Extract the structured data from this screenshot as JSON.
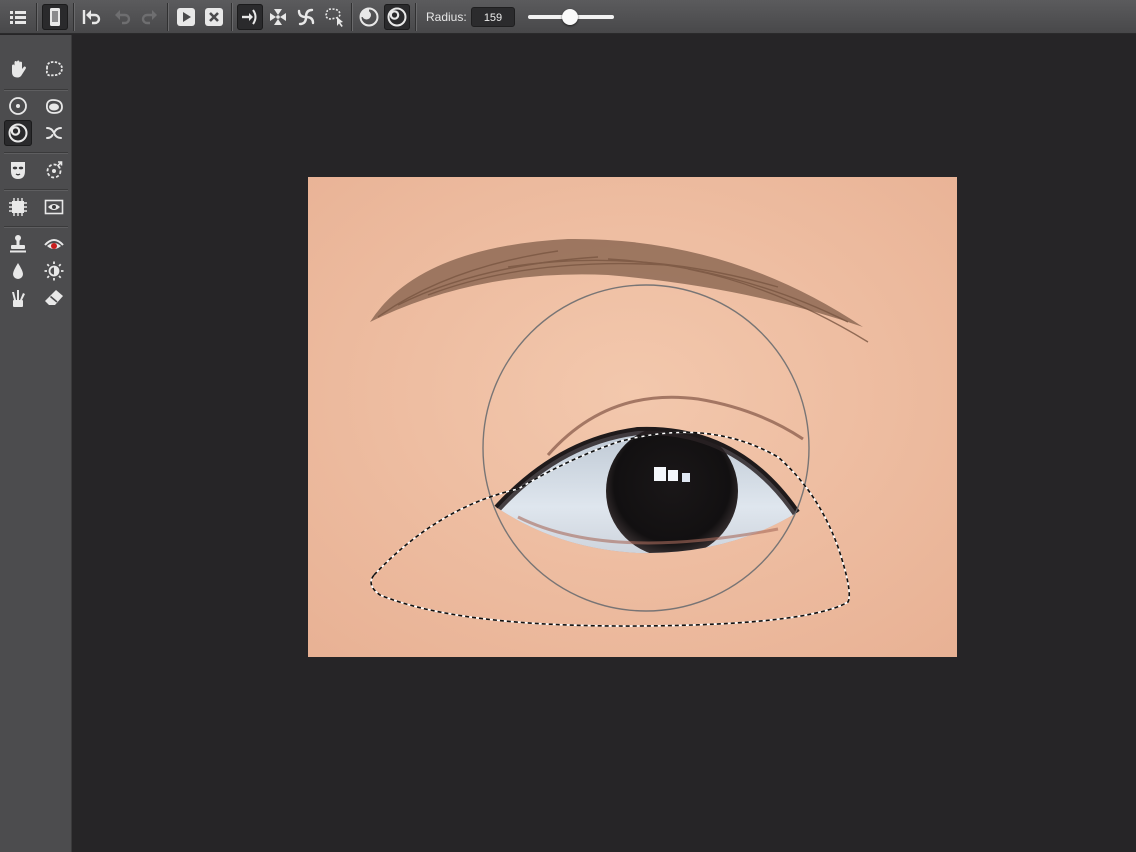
{
  "toolbar": {
    "radius_label": "Radius:",
    "radius_value": "159",
    "radius_slider_level": 0.49,
    "items": [
      {
        "name": "menu-icon"
      },
      {
        "name": "phone-icon",
        "active": true
      },
      {
        "name": "undo-all-icon"
      },
      {
        "name": "undo-icon"
      },
      {
        "name": "redo-icon"
      },
      {
        "name": "play-icon"
      },
      {
        "name": "cancel-icon"
      },
      {
        "name": "forward-warp-icon",
        "active": true
      },
      {
        "name": "pinch-icon"
      },
      {
        "name": "twirl-icon"
      },
      {
        "name": "lasso-select-icon"
      },
      {
        "name": "brush-mode-add-icon"
      },
      {
        "name": "brush-mode-subtract-icon",
        "active": true
      }
    ]
  },
  "sidebar": {
    "tools": [
      {
        "name": "hand-tool-icon"
      },
      {
        "name": "lasso-tool-icon"
      },
      {
        "name": "circle-select-icon"
      },
      {
        "name": "blob-select-icon"
      },
      {
        "name": "eye-enhance-icon",
        "active": true
      },
      {
        "name": "liquify-icon"
      },
      {
        "name": "mask-icon"
      },
      {
        "name": "target-icon"
      },
      {
        "name": "chip-icon"
      },
      {
        "name": "frame-eye-icon"
      },
      {
        "name": "stamp-icon"
      },
      {
        "name": "red-eye-icon"
      },
      {
        "name": "drop-icon"
      },
      {
        "name": "brightness-icon"
      },
      {
        "name": "brush-icon"
      },
      {
        "name": "eraser-icon"
      }
    ]
  },
  "colors": {
    "toolbar_bg": "#4f4f51",
    "sidebar_bg": "#4c4c4e",
    "canvas_bg": "#262527",
    "skin": "#eebb9f",
    "selection": "#ffffff"
  }
}
